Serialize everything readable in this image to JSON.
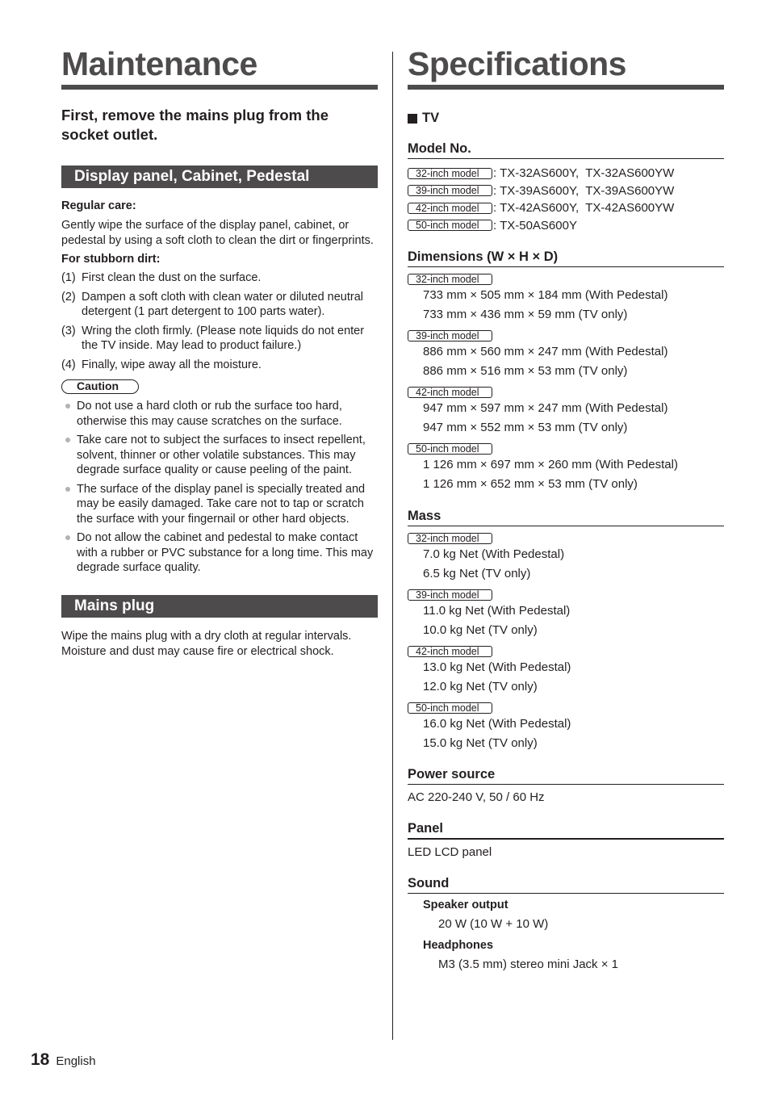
{
  "maintenance": {
    "title": "Maintenance",
    "lead": "First, remove the mains plug from the socket outlet.",
    "display_section": {
      "heading": "Display panel, Cabinet, Pedestal",
      "regular_care_label": "Regular care:",
      "regular_care_text": "Gently wipe the surface of the display panel, cabinet, or pedestal by using a soft cloth to clean the dirt or fingerprints.",
      "stubborn_label": "For stubborn dirt:",
      "steps": [
        {
          "num": "(1)",
          "text": "First clean the dust on the surface."
        },
        {
          "num": "(2)",
          "text": "Dampen a soft cloth with clean water or diluted neutral detergent (1 part detergent to 100 parts water)."
        },
        {
          "num": "(3)",
          "text": "Wring the cloth firmly. (Please note liquids do not enter the TV inside. May lead to product failure.)"
        },
        {
          "num": "(4)",
          "text": "Finally, wipe away all the moisture."
        }
      ],
      "caution_label": "Caution",
      "cautions": [
        "Do not use a hard cloth or rub the surface too hard, otherwise this may cause scratches on the surface.",
        "Take care not to subject the surfaces to insect repellent, solvent, thinner or other volatile substances. This may degrade surface quality or cause peeling of the paint.",
        "The surface of the display panel is specially treated and may be easily damaged. Take care not to tap or scratch the surface with your fingernail or other hard objects.",
        "Do not allow the cabinet and pedestal to make contact with a rubber or PVC substance for a long time. This may degrade surface quality."
      ]
    },
    "mains_section": {
      "heading": "Mains plug",
      "text": "Wipe the mains plug with a dry cloth at regular intervals. Moisture and dust may cause fire or electrical shock."
    }
  },
  "specifications": {
    "title": "Specifications",
    "tv_label": "TV",
    "model_no": {
      "heading": "Model No.",
      "rows": [
        {
          "badge": "32-inch model",
          "value": ": TX-32AS600Y,  TX-32AS600YW"
        },
        {
          "badge": "39-inch model",
          "value": ": TX-39AS600Y,  TX-39AS600YW"
        },
        {
          "badge": "42-inch model",
          "value": ": TX-42AS600Y,  TX-42AS600YW"
        },
        {
          "badge": "50-inch model",
          "value": ": TX-50AS600Y"
        }
      ]
    },
    "dimensions": {
      "heading": "Dimensions (W × H × D)",
      "models": [
        {
          "badge": "32-inch model",
          "with_pedestal": "733 mm × 505 mm × 184 mm (With Pedestal)",
          "tv_only": "733 mm × 436 mm × 59 mm (TV only)"
        },
        {
          "badge": "39-inch model",
          "with_pedestal": "886 mm × 560 mm × 247 mm (With Pedestal)",
          "tv_only": "886 mm × 516 mm × 53 mm (TV only)"
        },
        {
          "badge": "42-inch model",
          "with_pedestal": "947 mm × 597 mm × 247 mm (With Pedestal)",
          "tv_only": "947 mm × 552 mm × 53 mm (TV only)"
        },
        {
          "badge": "50-inch model",
          "with_pedestal": "1 126 mm × 697 mm × 260 mm (With Pedestal)",
          "tv_only": "1 126 mm × 652 mm × 53 mm (TV only)"
        }
      ]
    },
    "mass": {
      "heading": "Mass",
      "models": [
        {
          "badge": "32-inch model",
          "with_pedestal": "7.0 kg Net (With Pedestal)",
          "tv_only": "6.5 kg Net (TV only)"
        },
        {
          "badge": "39-inch model",
          "with_pedestal": "11.0 kg Net (With Pedestal)",
          "tv_only": "10.0 kg Net (TV only)"
        },
        {
          "badge": "42-inch model",
          "with_pedestal": "13.0 kg Net (With Pedestal)",
          "tv_only": "12.0 kg Net (TV only)"
        },
        {
          "badge": "50-inch model",
          "with_pedestal": "16.0 kg Net (With Pedestal)",
          "tv_only": "15.0 kg Net (TV only)"
        }
      ]
    },
    "power": {
      "heading": "Power source",
      "value": "AC 220-240 V, 50 / 60 Hz"
    },
    "panel": {
      "heading": "Panel",
      "value": "LED LCD panel"
    },
    "sound": {
      "heading": "Sound",
      "speaker_label": "Speaker output",
      "speaker_value": "20 W (10 W + 10 W)",
      "headphones_label": "Headphones",
      "headphones_value": "M3 (3.5 mm) stereo mini Jack × 1"
    }
  },
  "footer": {
    "page_number": "18",
    "language": "English"
  }
}
